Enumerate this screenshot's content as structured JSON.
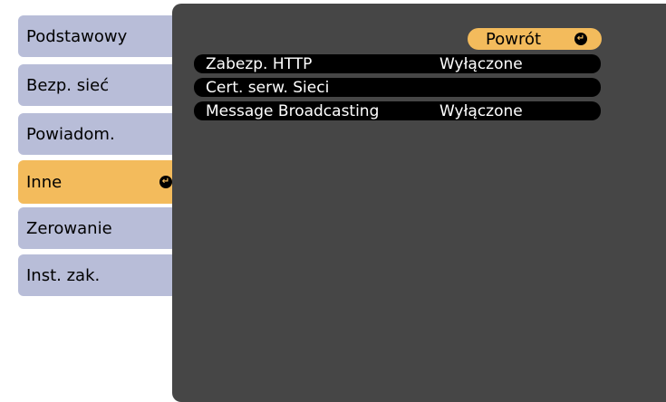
{
  "sidebar": {
    "items": [
      {
        "label": "Podstawowy"
      },
      {
        "label": "Bezp. sieć"
      },
      {
        "label": "Powiadom."
      },
      {
        "label": "Inne",
        "active": true
      },
      {
        "label": "Zerowanie"
      },
      {
        "label": "Inst. zak."
      }
    ]
  },
  "panel": {
    "back_label": "Powrót",
    "rows": [
      {
        "label": "Zabezp. HTTP",
        "value": "Wyłączone"
      },
      {
        "label": "Cert. serw. Sieci",
        "value": ""
      },
      {
        "label": "Message Broadcasting",
        "value": "Wyłączone"
      }
    ]
  },
  "colors": {
    "menu_bg": "#b8bdd8",
    "menu_active": "#f3bb5c",
    "panel_bg": "#464646",
    "row_bg": "#000000"
  },
  "icons": {
    "enter": "enter-icon"
  }
}
